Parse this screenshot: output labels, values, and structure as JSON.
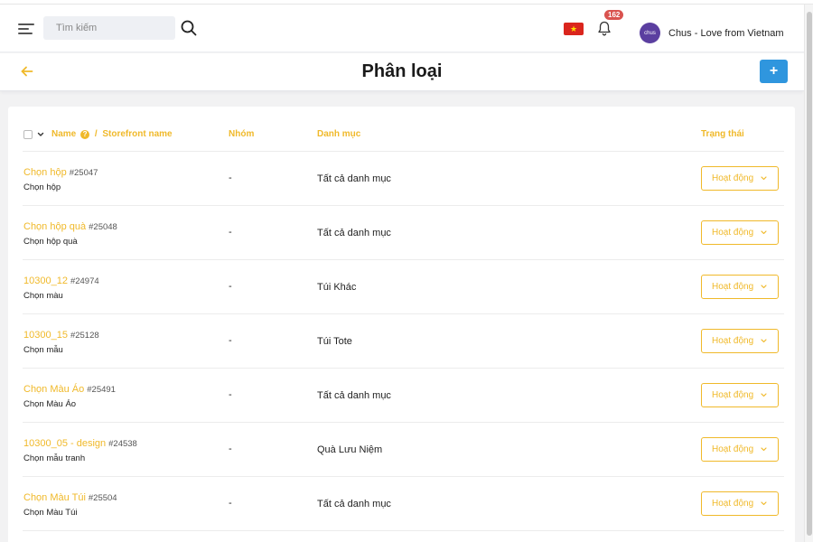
{
  "topbar": {
    "search_placeholder": "Tìm kiếm",
    "notification_count": "162",
    "avatar_text": "chus",
    "user_name": "Chus - Love from Vietnam",
    "flag_star": "★"
  },
  "header": {
    "title": "Phân loại",
    "add_label": "+"
  },
  "table": {
    "columns": {
      "name": "Name",
      "separator": "/",
      "storefront": "Storefront name",
      "group": "Nhóm",
      "category": "Danh mục",
      "status": "Trạng thái"
    },
    "rows": [
      {
        "name": "Chọn hộp",
        "code": "#25047",
        "storefront": "Chọn hộp",
        "group": "-",
        "category": "Tất cả danh mục",
        "status": "Hoạt động"
      },
      {
        "name": "Chọn hộp quà",
        "code": "#25048",
        "storefront": "Chọn hộp quà",
        "group": "-",
        "category": "Tất cả danh mục",
        "status": "Hoạt động"
      },
      {
        "name": "10300_12",
        "code": "#24974",
        "storefront": "Chọn màu",
        "group": "-",
        "category": "Túi Khác",
        "status": "Hoạt động"
      },
      {
        "name": "10300_15",
        "code": "#25128",
        "storefront": "Chọn mẫu",
        "group": "-",
        "category": "Túi Tote",
        "status": "Hoạt động"
      },
      {
        "name": "Chọn Màu Áo",
        "code": "#25491",
        "storefront": "Chọn Màu Áo",
        "group": "-",
        "category": "Tất cả danh mục",
        "status": "Hoạt động"
      },
      {
        "name": "10300_05 - design",
        "code": "#24538",
        "storefront": "Chọn mẫu tranh",
        "group": "-",
        "category": "Quà Lưu Niệm",
        "status": "Hoạt động"
      },
      {
        "name": "Chọn Màu Túi",
        "code": "#25504",
        "storefront": "Chọn Màu Túi",
        "group": "-",
        "category": "Tất cả danh mục",
        "status": "Hoạt động"
      }
    ]
  },
  "colors": {
    "accent": "#f0b92a",
    "primary_button": "#2f96de",
    "badge": "#d9534f"
  }
}
